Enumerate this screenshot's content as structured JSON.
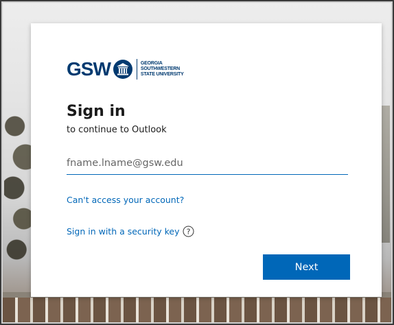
{
  "branding": {
    "logo_letters": "GSW",
    "university_name_lines": [
      "GEORGIA",
      "SOUTHWESTERN",
      "STATE UNIVERSITY"
    ],
    "brand_color": "#003a70"
  },
  "signin": {
    "title": "Sign in",
    "subtitle": "to continue to Outlook",
    "email_placeholder": "fname.lname@gsw.edu",
    "email_value": "",
    "cant_access_link": "Can't access your account?",
    "security_key_link": "Sign in with a security key",
    "help_icon": "question-circle-icon",
    "next_button": "Next",
    "accent_color": "#0067b8"
  }
}
